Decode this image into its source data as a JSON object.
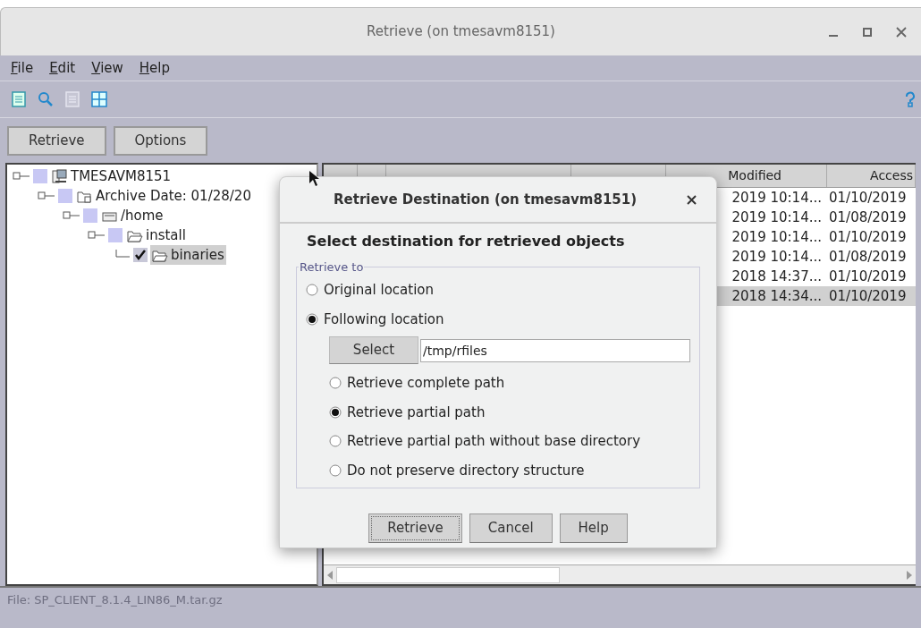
{
  "window": {
    "title": "Retrieve (on tmesavm8151)"
  },
  "menu": [
    {
      "label": "File"
    },
    {
      "label": "Edit"
    },
    {
      "label": "View"
    },
    {
      "label": "Help"
    }
  ],
  "toolbar": [
    {
      "kind": "document",
      "disabled": false
    },
    {
      "kind": "search",
      "disabled": false
    },
    {
      "kind": "list",
      "disabled": true
    },
    {
      "kind": "grid",
      "disabled": false
    }
  ],
  "buttons": [
    "Retrieve",
    "Options"
  ],
  "tree": [
    {
      "label": "TMESAVM8151",
      "kind": "computer",
      "checked": false,
      "selected": false,
      "children": [
        {
          "label": "Archive Date: 01/28/20",
          "kind": "archive",
          "checked": false,
          "selected": false,
          "children": [
            {
              "label": "/home",
              "kind": "drive",
              "checked": false,
              "selected": false,
              "children": [
                {
                  "label": "install",
                  "kind": "folder",
                  "checked": false,
                  "selected": false,
                  "children": [
                    {
                      "label": "binaries",
                      "kind": "folder",
                      "checked": true,
                      "selected": true
                    }
                  ]
                }
              ]
            }
          ]
        }
      ]
    }
  ],
  "table": {
    "columns": [
      "Modified",
      "Access"
    ],
    "rows": [
      {
        "modified": "2019 10:14...",
        "access": "01/10/2019",
        "selected": false
      },
      {
        "modified": "2019 10:14...",
        "access": "01/08/2019",
        "selected": false
      },
      {
        "modified": "2019 10:14...",
        "access": "01/10/2019",
        "selected": false
      },
      {
        "modified": "2019 10:14...",
        "access": "01/08/2019",
        "selected": false
      },
      {
        "modified": "2018 14:37...",
        "access": "01/10/2019",
        "selected": false
      },
      {
        "modified": "2018 14:34...",
        "access": "01/10/2019",
        "selected": true
      }
    ]
  },
  "status_bar": "File: SP_CLIENT_8.1.4_LIN86_M.tar.gz",
  "dialog": {
    "title": "Retrieve Destination (on tmesavm8151)",
    "heading": "Select destination for retrieved objects",
    "group": "Retrieve to",
    "locations": [
      {
        "label": "Original location",
        "selected": false
      },
      {
        "label": "Following location",
        "selected": true
      }
    ],
    "select_button": "Select",
    "path": "/tmp/rfiles",
    "path_options": [
      {
        "label": "Retrieve complete path",
        "selected": false
      },
      {
        "label": "Retrieve partial path",
        "selected": true
      },
      {
        "label": "Retrieve partial path without base directory",
        "selected": false
      },
      {
        "label": "Do not preserve directory structure",
        "selected": false
      }
    ],
    "buttons": [
      {
        "label": "Retrieve",
        "default": true
      },
      {
        "label": "Cancel",
        "default": false
      },
      {
        "label": "Help",
        "default": false
      }
    ]
  }
}
